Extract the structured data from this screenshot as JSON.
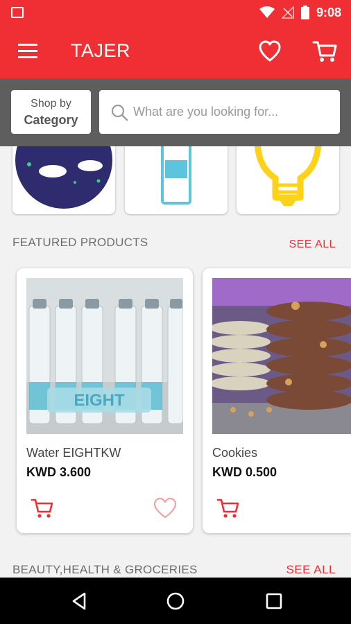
{
  "status_bar": {
    "time": "9:08",
    "icons": [
      "image-notification-icon",
      "wifi-icon",
      "no-signal-icon",
      "battery-icon"
    ]
  },
  "app_bar": {
    "title": "TAJER",
    "icons": [
      "menu-icon",
      "heart-icon",
      "cart-icon"
    ]
  },
  "search_bar": {
    "shop_by_line1": "Shop by",
    "shop_by_line2": "Category",
    "placeholder": "What are you looking for..."
  },
  "categories": [
    {
      "icon": "moon-night-icon"
    },
    {
      "icon": "water-bottle-icon"
    },
    {
      "icon": "light-bulb-icon"
    }
  ],
  "featured": {
    "title": "FEATURED PRODUCTS",
    "see_all": "SEE ALL",
    "products": [
      {
        "name": "Water EIGHTKW",
        "price": "KWD 3.600",
        "image_text": "EIGHT"
      },
      {
        "name": "Cookies",
        "price": "KWD 0.500"
      }
    ]
  },
  "beauty": {
    "title": "BEAUTY,HEALTH & GROCERIES",
    "see_all": "SEE ALL"
  },
  "nav_bar": {
    "icons": [
      "back-icon",
      "home-icon",
      "recents-icon"
    ]
  },
  "colors": {
    "primary": "#f02f34",
    "search_band": "#5e5e5e",
    "background": "#f2f2f2"
  }
}
